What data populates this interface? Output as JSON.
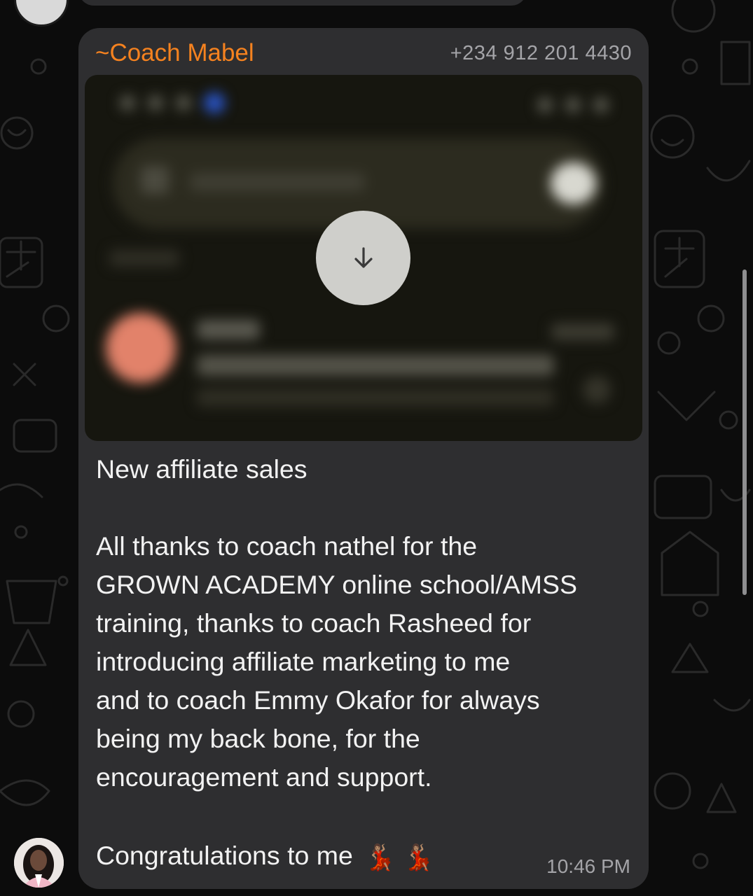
{
  "message": {
    "sender_name": "~Coach Mabel",
    "sender_phone": "+234 912 201 4430",
    "lines": [
      "New affiliate sales",
      "",
      "All thanks to coach nathel for the",
      "GROWN ACADEMY online school/AMSS",
      "training, thanks to coach Rasheed for",
      "introducing affiliate marketing to me",
      "and to coach Emmy Okafor for always",
      "being my back bone, for the",
      "encouragement and support.",
      ""
    ],
    "last_line": "Congratulations to me",
    "last_line_emoji": "💃🏽 💃🏽",
    "timestamp": "10:46 PM"
  },
  "media": {
    "state": "blurred-not-downloaded",
    "action_icon": "download-arrow-icon"
  },
  "colors": {
    "sender_name": "#f5821f",
    "bubble": "#2e2e30",
    "background": "#0c0c0c",
    "download_button": "#cfcfcb"
  }
}
